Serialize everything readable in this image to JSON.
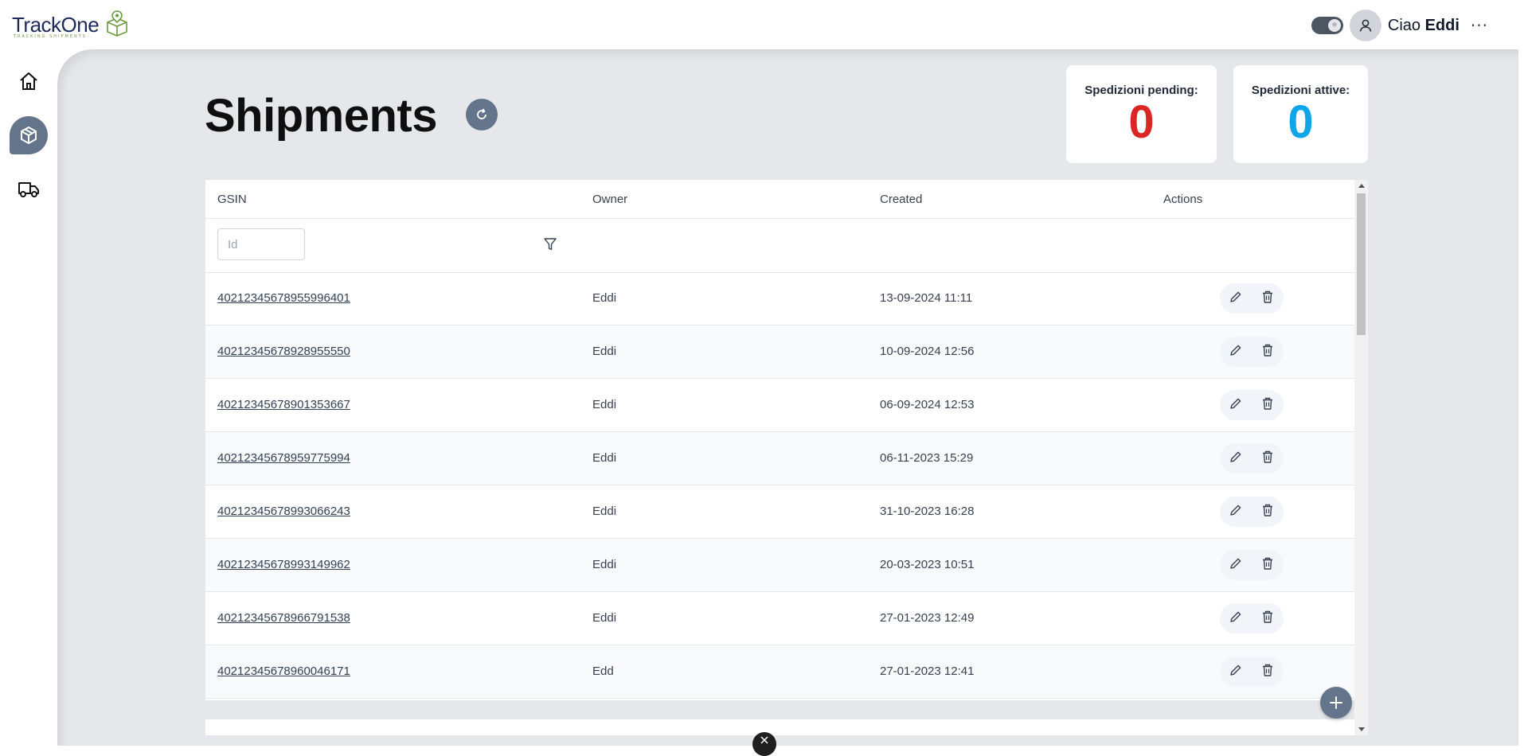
{
  "app": {
    "logo_text": "TrackOne",
    "logo_sub": "TRACKING SHIPMENTS"
  },
  "header": {
    "greeting_prefix": "Ciao",
    "user_name": "Eddi",
    "more_label": "···"
  },
  "sidebar": {
    "items": [
      {
        "name": "home",
        "icon": "home-icon"
      },
      {
        "name": "shipments",
        "icon": "package-icon",
        "active": true
      },
      {
        "name": "vehicles",
        "icon": "truck-icon"
      }
    ]
  },
  "page": {
    "title": "Shipments"
  },
  "stats": {
    "pending_label": "Spedizioni pending:",
    "pending_value": "0",
    "pending_color": "#dc2626",
    "active_label": "Spedizioni attive:",
    "active_value": "0",
    "active_color": "#0ea5e9"
  },
  "table": {
    "columns": [
      "GSIN",
      "Owner",
      "Created",
      "Actions"
    ],
    "filter_placeholder": "Id",
    "rows": [
      {
        "gsin": "40212345678955996401",
        "owner": "Eddi",
        "created": "13-09-2024 11:11"
      },
      {
        "gsin": "40212345678928955550",
        "owner": "Eddi",
        "created": "10-09-2024 12:56"
      },
      {
        "gsin": "40212345678901353667",
        "owner": "Eddi",
        "created": "06-09-2024 12:53"
      },
      {
        "gsin": "40212345678959775994",
        "owner": "Eddi",
        "created": "06-11-2023 15:29"
      },
      {
        "gsin": "40212345678993066243",
        "owner": "Eddi",
        "created": "31-10-2023 16:28"
      },
      {
        "gsin": "40212345678993149962",
        "owner": "Eddi",
        "created": "20-03-2023 10:51"
      },
      {
        "gsin": "40212345678966791538",
        "owner": "Eddi",
        "created": "27-01-2023 12:49"
      },
      {
        "gsin": "40212345678960046171",
        "owner": "Edd",
        "created": "27-01-2023 12:41"
      }
    ]
  },
  "colors": {
    "accent": "#64748b",
    "background": "#e5e7eb"
  }
}
